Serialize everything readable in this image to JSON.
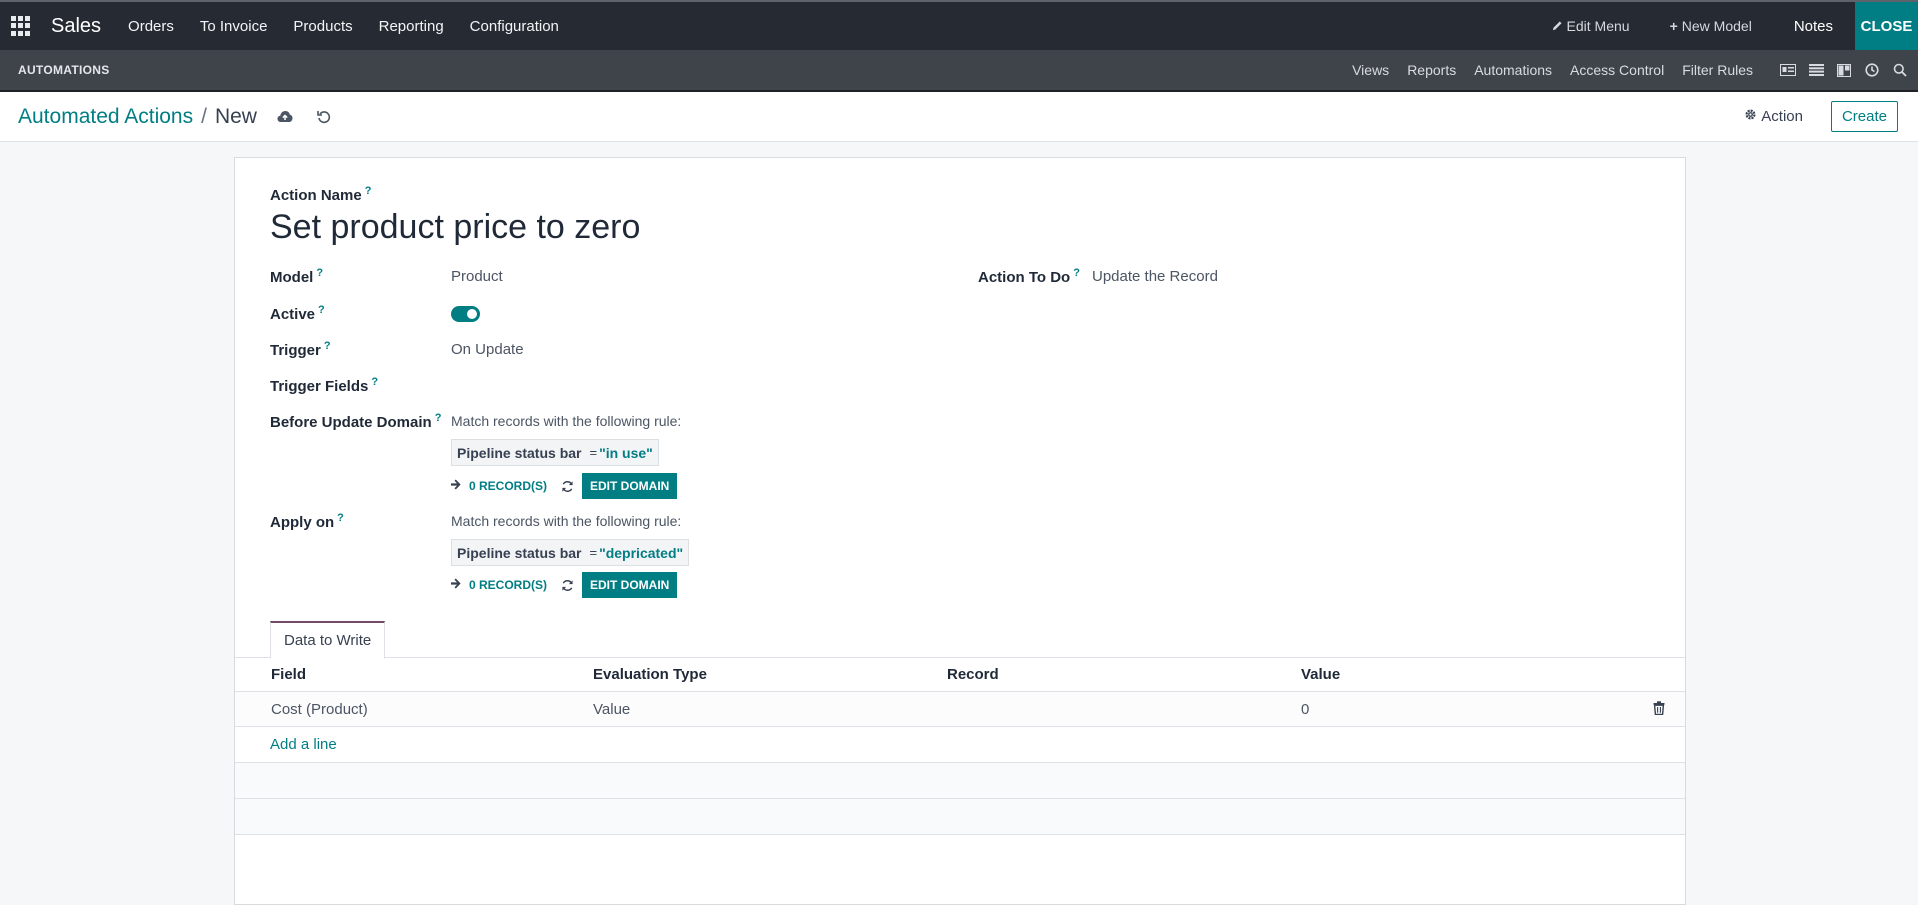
{
  "topbar": {
    "app_name": "Sales",
    "nav": [
      "Orders",
      "To Invoice",
      "Products",
      "Reporting",
      "Configuration"
    ],
    "edit_menu": "Edit Menu",
    "new_model": "New Model",
    "notes": "Notes",
    "close": "CLOSE"
  },
  "studio": {
    "title": "AUTOMATIONS",
    "menu": [
      "Views",
      "Reports",
      "Automations",
      "Access Control",
      "Filter Rules"
    ]
  },
  "breadcrumb": {
    "parent": "Automated Actions",
    "separator": "/",
    "current": "New"
  },
  "controls": {
    "action_label": "Action",
    "create_label": "Create"
  },
  "form": {
    "action_name_label": "Action Name",
    "action_name": "Set product price to zero",
    "model_label": "Model",
    "model_value": "Product",
    "action_to_do_label": "Action To Do",
    "action_to_do_value": "Update the Record",
    "active_label": "Active",
    "active_value": true,
    "trigger_label": "Trigger",
    "trigger_value": "On Update",
    "trigger_fields_label": "Trigger Fields",
    "before_update_label": "Before Update Domain",
    "before_update": {
      "intro": "Match records with the following rule:",
      "field": "Pipeline status bar",
      "operator": "=",
      "value": "\"in use\"",
      "records": "0 RECORD(S)",
      "edit_domain": "EDIT DOMAIN"
    },
    "apply_on_label": "Apply on",
    "apply_on": {
      "intro": "Match records with the following rule:",
      "field": "Pipeline status bar",
      "operator": "=",
      "value": "\"depricated\"",
      "records": "0 RECORD(S)",
      "edit_domain": "EDIT DOMAIN"
    }
  },
  "tabs": {
    "active": "Data to Write"
  },
  "table": {
    "headers": [
      "Field",
      "Evaluation Type",
      "Record",
      "Value"
    ],
    "rows": [
      {
        "field": "Cost (Product)",
        "evaluation_type": "Value",
        "record": "",
        "value": "0"
      }
    ],
    "add_line": "Add a line"
  },
  "colors": {
    "accent": "#017e84",
    "topbar_bg": "#262b33",
    "studio_bg": "#3f444b",
    "tab_accent": "#714b67"
  }
}
